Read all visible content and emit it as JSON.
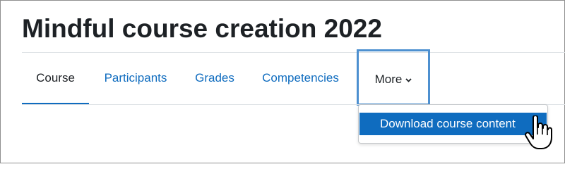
{
  "page": {
    "title": "Mindful course creation 2022"
  },
  "nav": {
    "tabs": [
      {
        "label": "Course",
        "active": true
      },
      {
        "label": "Participants",
        "active": false
      },
      {
        "label": "Grades",
        "active": false
      },
      {
        "label": "Competencies",
        "active": false
      },
      {
        "label": "More",
        "active": false,
        "focused": true
      }
    ]
  },
  "more_menu": {
    "items": [
      {
        "label": "Download course content",
        "highlighted": true
      }
    ]
  },
  "icons": {
    "more_chevron": "chevron-down-icon",
    "pointer": "hand-pointer-icon"
  },
  "colors": {
    "link": "#0f6cbf",
    "text": "#1d2125",
    "focus_ring": "#4d90d0",
    "highlight_bg": "#0f6cbf",
    "divider": "#dee2e6"
  }
}
